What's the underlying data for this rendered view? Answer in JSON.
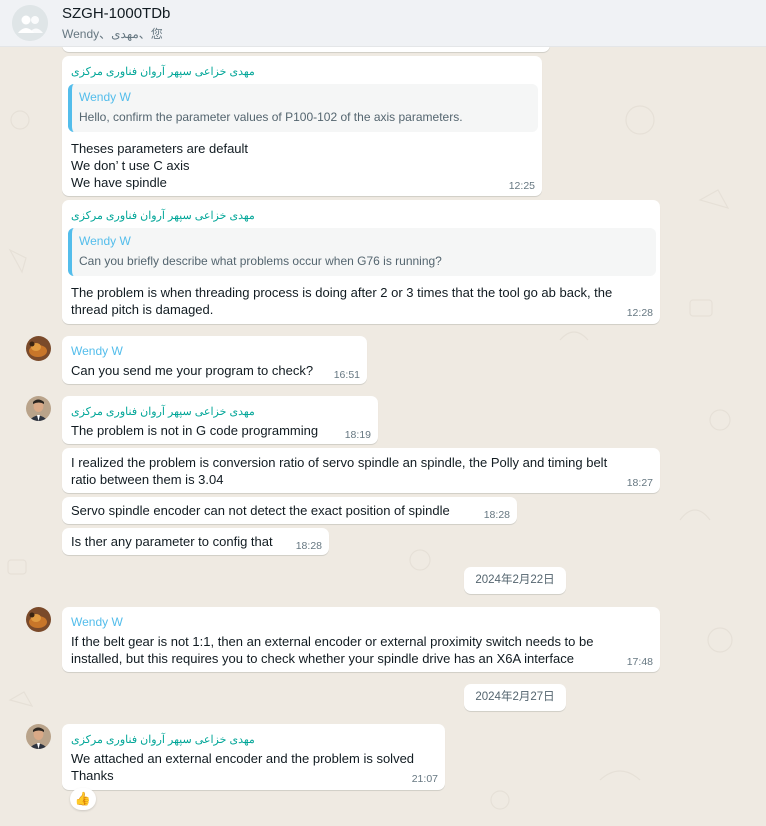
{
  "header": {
    "title": "SZGH-1000TDb",
    "members": "Wendy、مهدی、您"
  },
  "messages": {
    "m1": {
      "sender": "مهدی خزاعی سپهر آروان فناوری مرکزی",
      "quote_name": "Wendy W",
      "quote_text": "Hello, confirm the parameter values of P100-102 of the axis parameters.",
      "line1": "Theses parameters are default",
      "line2": "We don’ t use C axis",
      "line3": "We have spindle",
      "time": "12:25"
    },
    "m2": {
      "sender": "مهدی خزاعی سپهر آروان فناوری مرکزی",
      "quote_name": "Wendy W",
      "quote_text": "Can you briefly describe what problems occur when G76 is running?",
      "line1": "The problem is when threading process is doing after 2 or 3 times that the tool go ab back, the",
      "line2": "thread pitch is damaged.",
      "time": "12:28"
    },
    "m3": {
      "sender": "Wendy W",
      "text": "Can you send me your program to check?",
      "time": "16:51"
    },
    "m4": {
      "sender": "مهدی خزاعی سپهر آروان فناوری مرکزی",
      "text": "The problem is not in G code programming",
      "time": "18:19"
    },
    "m5": {
      "line1": "I realized the problem is conversion ratio of servo spindle an spindle, the Polly and timing belt",
      "line2": "ratio between them is 3.04",
      "time": "18:27"
    },
    "m6": {
      "text": "Servo spindle encoder can not detect the exact position of spindle",
      "time": "18:28"
    },
    "m7": {
      "text": "Is ther any parameter to config that",
      "time": "18:28"
    },
    "date1": "2024年2月22日",
    "m8": {
      "sender": "Wendy W",
      "line1": "If the belt gear is not 1:1, then an external encoder or external proximity switch needs to be",
      "line2": "installed, but this requires you to check whether your spindle drive has an X6A interface",
      "time": "17:48"
    },
    "date2": "2024年2月27日",
    "m9": {
      "sender": "مهدی خزاعی سپهر آروان فناوری مرکزی",
      "line1": "We attached an external encoder and the problem is solved",
      "line2": "Thanks",
      "time": "21:07",
      "reaction": "👍"
    }
  },
  "colors": {
    "background": "#efeae2",
    "sender_green": "#02a698",
    "sender_blue": "#53bdeb",
    "bubble": "#ffffff"
  }
}
